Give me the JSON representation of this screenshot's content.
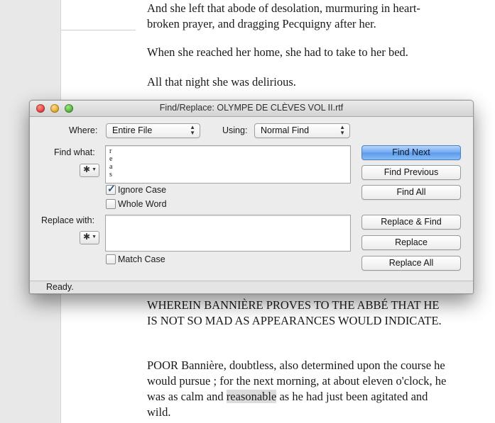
{
  "document": {
    "paragraphs": [
      "And she left that abode of desolation, murmuring in heart-broken prayer, and dragging Pecquigny after her.",
      "When she reached her home, she had to take to her bed.",
      "All that night she was delirious.",
      "WHEREIN BANNIÈRE PROVES TO THE ABBÉ THAT HE IS NOT SO MAD AS APPEARANCES WOULD INDICATE."
    ],
    "last_para_before": "POOR Bannière, doubtless, also determined upon the course he would pursue ; for the next morning, at about eleven o'clock, he was as calm and ",
    "last_para_highlight": "reasonable",
    "last_para_after": " as he had just been agitated and wild."
  },
  "dialog": {
    "title": "Find/Replace: OLYMPE DE CLÈVES VOL II.rtf",
    "where_label": "Where:",
    "where_value": "Entire File",
    "using_label": "Using:",
    "using_value": "Normal Find",
    "find_label": "Find what:",
    "find_value": "r\ne\na\ns",
    "replace_label": "Replace with:",
    "replace_value": "",
    "ignore_case_label": "Ignore Case",
    "ignore_case_checked": true,
    "whole_word_label": "Whole Word",
    "whole_word_checked": false,
    "match_case_label": "Match Case",
    "match_case_checked": false,
    "buttons": {
      "find_next": "Find Next",
      "find_previous": "Find Previous",
      "find_all": "Find All",
      "replace_and_find": "Replace & Find",
      "replace": "Replace",
      "replace_all": "Replace All"
    },
    "status": "Ready."
  },
  "icons": {
    "window_close": "close-icon",
    "window_minimize": "minimize-icon",
    "window_zoom": "zoom-icon",
    "gear": "gear-icon",
    "popup_arrows": "updown-arrows-icon",
    "checkmark": "checkmark-icon"
  },
  "colors": {
    "primary_button": "#6fa8ef",
    "traffic_close": "#e0443e",
    "traffic_minimize": "#e6a42b",
    "traffic_zoom": "#54b33a",
    "highlight": "#dcdcdc"
  }
}
